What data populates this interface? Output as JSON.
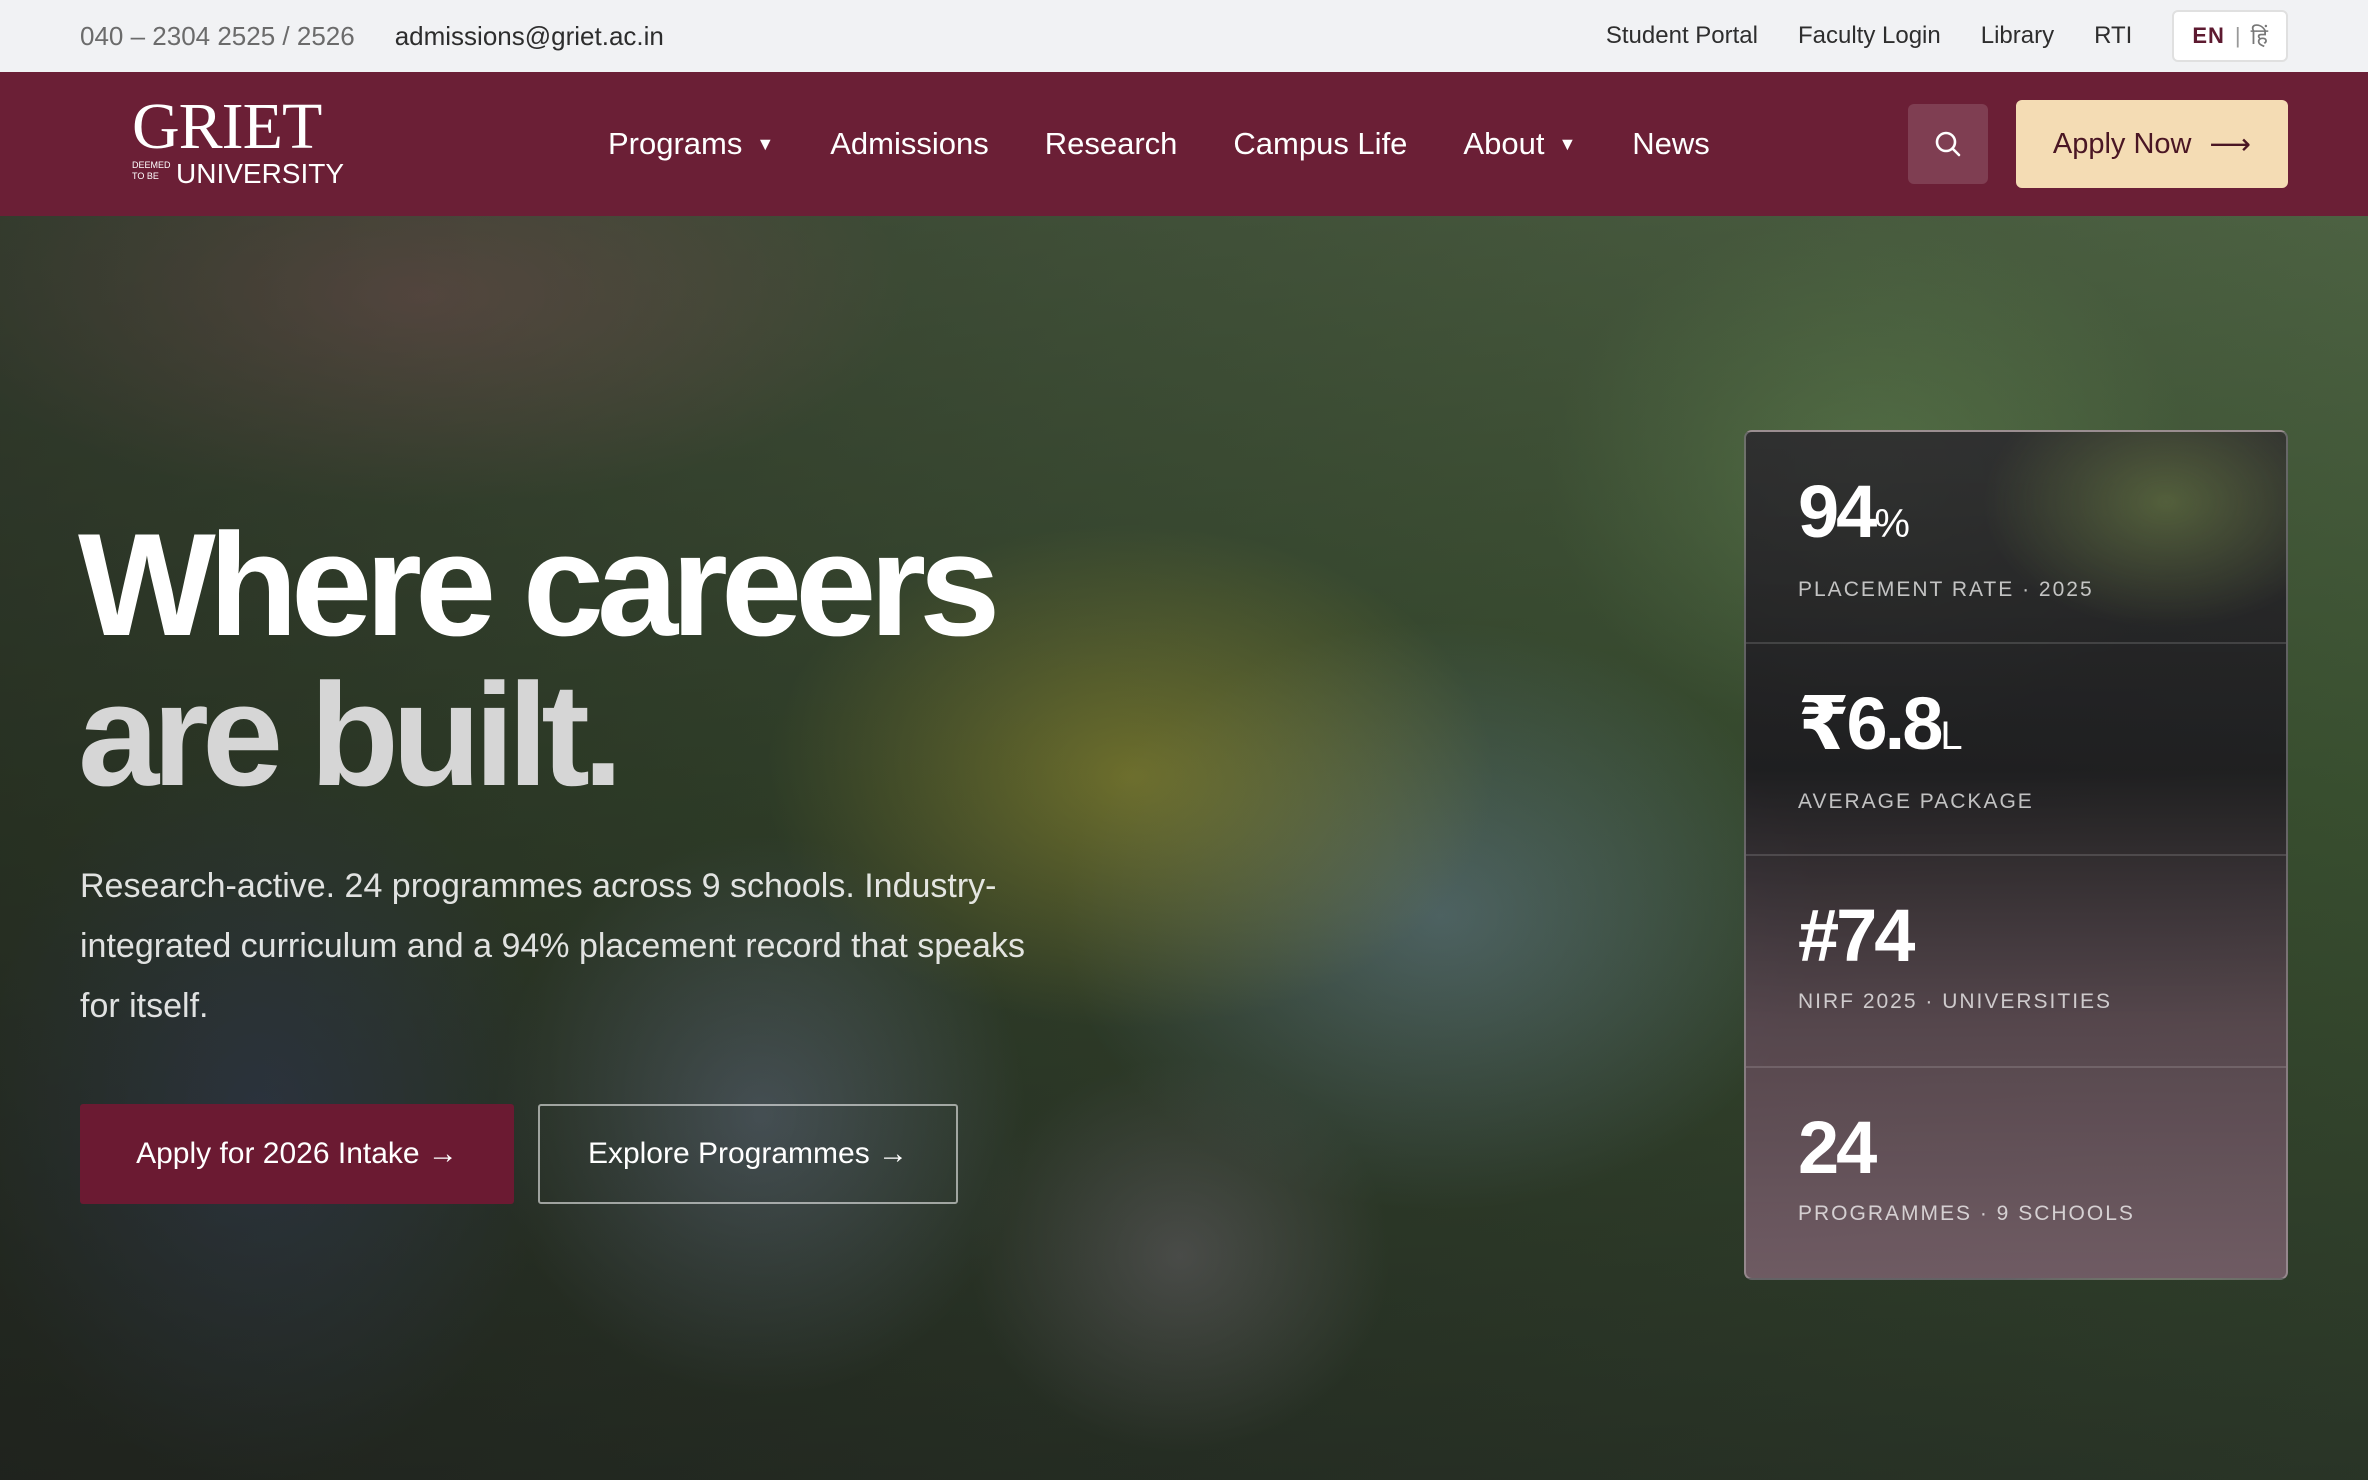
{
  "utility": {
    "phone": "040 – 2304 2525 / 2526",
    "email": "admissions@griet.ac.in",
    "links": [
      "Student Portal",
      "Faculty Login",
      "Library",
      "RTI"
    ],
    "lang": {
      "en": "EN",
      "separator": "|",
      "hi": "हिं"
    }
  },
  "nav": {
    "logo": {
      "wordmark": "GRIET",
      "deemed": "DEEMED TO BE",
      "university": "UNIVERSITY"
    },
    "items": [
      {
        "label": "Programs",
        "has_caret": true
      },
      {
        "label": "Admissions"
      },
      {
        "label": "Research"
      },
      {
        "label": "Campus Life"
      },
      {
        "label": "About",
        "has_caret": true
      },
      {
        "label": "News"
      }
    ],
    "caret": "▼",
    "search_icon": "search-icon",
    "apply_label": "Apply Now",
    "apply_arrow": "⟶"
  },
  "hero": {
    "headline_line1": "Where careers",
    "headline_line2": "are built.",
    "subtext": "Research-active. 24 programmes across 9 schools. Industry-integrated curriculum and a 94% placement record that speaks for itself.",
    "cta_primary": "Apply for 2026 Intake →",
    "cta_secondary": "Explore Programmes →"
  },
  "stats": [
    {
      "value": "94",
      "suffix": "%",
      "label": "PLACEMENT RATE · 2025"
    },
    {
      "value": "₹6.8",
      "suffix": "L",
      "label": "AVERAGE PACKAGE"
    },
    {
      "value": "#74",
      "suffix": "",
      "label": "NIRF 2025 · UNIVERSITIES"
    },
    {
      "value": "24",
      "suffix": "",
      "label": "PROGRAMMES · 9 SCHOOLS"
    }
  ],
  "colors": {
    "brand_maroon": "#6b1f36",
    "cta_maroon": "#6b1a32",
    "apply_cream": "#f4dcb4",
    "utility_bg": "#f1f2f4"
  }
}
